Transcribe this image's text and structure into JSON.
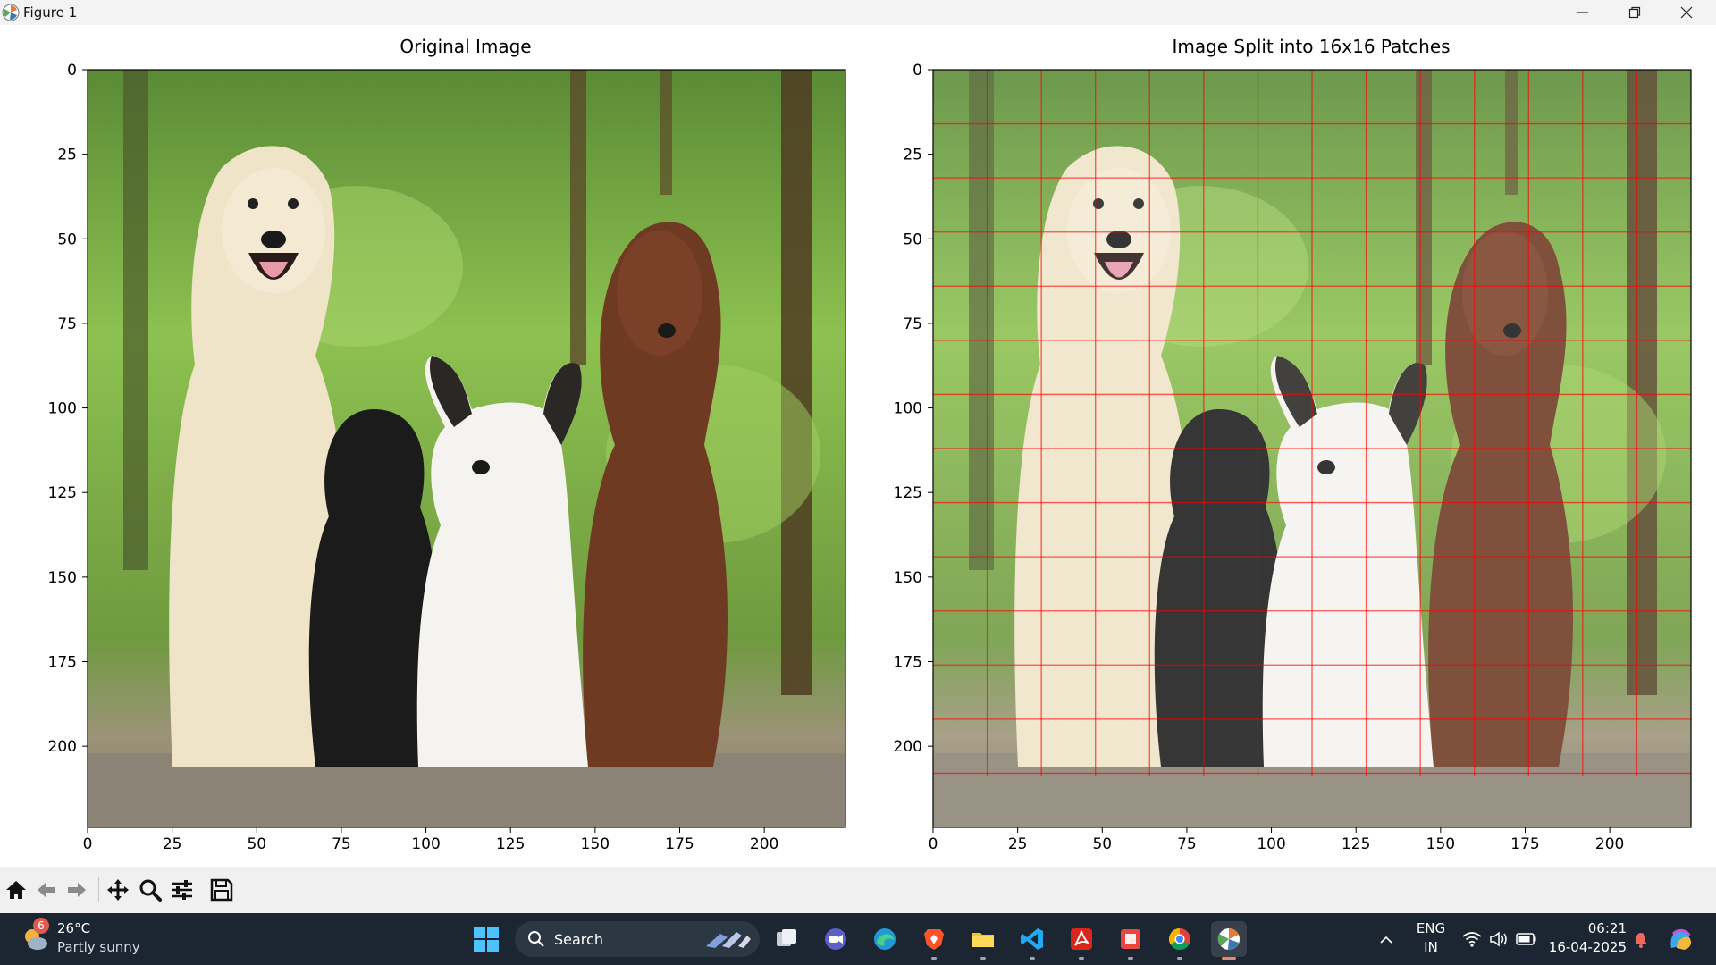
{
  "window": {
    "title": "Figure 1"
  },
  "figure": {
    "subplots": [
      {
        "title": "Original Image",
        "show_grid": false
      },
      {
        "title": "Image Split into 16x16 Patches",
        "show_grid": true,
        "patch_size": 16,
        "grid_color": "#ff0000"
      }
    ],
    "x_ticks": [
      "0",
      "25",
      "50",
      "75",
      "100",
      "125",
      "150",
      "175",
      "200"
    ],
    "y_ticks": [
      "0",
      "25",
      "50",
      "75",
      "100",
      "125",
      "150",
      "175",
      "200"
    ],
    "tick_values": [
      0,
      25,
      50,
      75,
      100,
      125,
      150,
      175,
      200
    ],
    "extent": [
      0,
      224
    ],
    "image_description_note": ""
  },
  "toolbar": {
    "buttons": [
      "home",
      "back",
      "forward",
      "pan",
      "zoom",
      "configure-subplots",
      "save"
    ]
  },
  "taskbar": {
    "weather": {
      "temp": "26°C",
      "desc": "Partly sunny",
      "badge": "6"
    },
    "search": {
      "label": "Search"
    },
    "tray": {
      "lang_top": "ENG",
      "lang_bottom": "IN",
      "time": "06:21",
      "date": "16-04-2025"
    }
  },
  "colors": {
    "taskbar_bg": "#1c2633",
    "toolbar_bg": "#f0f0f0",
    "grid": "#ff0000",
    "accent": "#e9866d"
  }
}
